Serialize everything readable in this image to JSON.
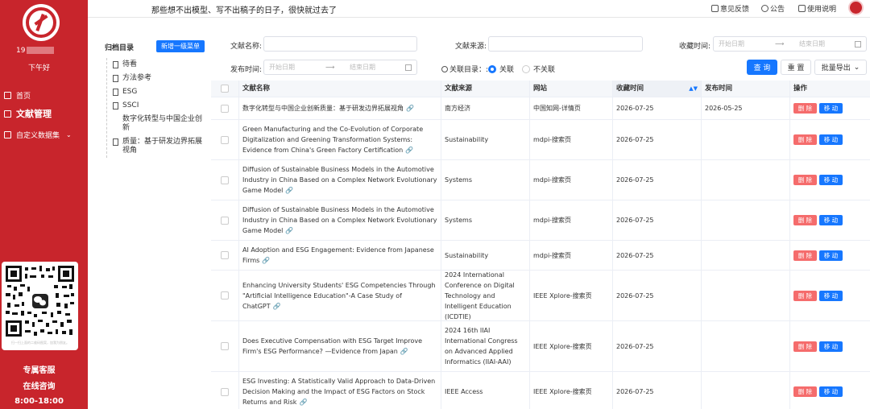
{
  "sidebar": {
    "user_id_prefix": "19",
    "greeting": "下午好",
    "nav": [
      {
        "label": "首页",
        "icon": "home-icon"
      },
      {
        "label": "文献管理",
        "icon": "document-icon"
      },
      {
        "label": "自定义数据集",
        "icon": "dataset-icon"
      }
    ],
    "qr_caption": "扫一扫上面的二维码图案，加我为朋友。",
    "service_label": "专属客服",
    "online_label": "在线咨询",
    "hours": "8:00-18:00",
    "brand_color": "#c8252c"
  },
  "topbar": {
    "slogan": "那些想不出模型、写不出稿子的日子，很快就过去了",
    "feedback": "意见反馈",
    "notice": "公告",
    "manual": "使用说明"
  },
  "tree": {
    "title": "归档目录",
    "add_button": "新增一级菜单",
    "items": [
      {
        "label": "待看",
        "doc": true
      },
      {
        "label": "方法参考",
        "doc": true
      },
      {
        "label": "ESG",
        "doc": true
      },
      {
        "label": "SSCI",
        "doc": true
      },
      {
        "label": "数字化转型与中国企业创新",
        "doc": false
      },
      {
        "label": "质量：基于研发边界拓展视角",
        "doc": true
      }
    ]
  },
  "filters": {
    "title_label": "文献名称:",
    "source_label": "文献来源:",
    "collect_time_label": "收藏时间:",
    "publish_time_label": "发布时间:",
    "start_placeholder": "开始日期",
    "end_placeholder": "结束日期",
    "date_arrow": "⟶",
    "related_label": "关联目录：:",
    "related_yes": "关联",
    "related_no": "不关联",
    "search_button": "查 询",
    "reset_button": "重 置",
    "export_button": "批量导出",
    "accent_color": "#1677ff"
  },
  "table": {
    "headers": [
      "文献名称",
      "文献来源",
      "网站",
      "收藏时间",
      "发布时间",
      "操作"
    ],
    "delete_label": "删 除",
    "move_label": "移 动",
    "link_glyph": "🔗",
    "rows": [
      {
        "title": "数字化转型与中国企业创新质量：基于研发边界拓展视角",
        "source": "南方经济",
        "site": "中国知网-详情页",
        "collected": "2026-07-25",
        "published": "2026-05-25"
      },
      {
        "title": "Green Manufacturing and the Co-Evolution of Corporate Digitalization and Greening Transformation Systems: Evidence from China's Green Factory Certification",
        "source": "Sustainability",
        "site": "mdpi-搜索页",
        "collected": "2026-07-25",
        "published": ""
      },
      {
        "title": "Diffusion of Sustainable Business Models in the Automotive Industry in China Based on a Complex Network Evolutionary Game Model",
        "source": "Systems",
        "site": "mdpi-搜索页",
        "collected": "2026-07-25",
        "published": ""
      },
      {
        "title": "Diffusion of Sustainable Business Models in the Automotive Industry in China Based on a Complex Network Evolutionary Game Model",
        "source": "Systems",
        "site": "mdpi-搜索页",
        "collected": "2026-07-25",
        "published": ""
      },
      {
        "title": "AI Adoption and ESG Engagement: Evidence from Japanese Firms",
        "source": "Sustainability",
        "site": "mdpi-搜索页",
        "collected": "2026-07-25",
        "published": ""
      },
      {
        "title": "Enhancing University Students' ESG Competencies Through \"Artificial Intelligence Education\"-A Case Study of ChatGPT",
        "source": "2024 International Conference on Digital Technology and Intelligent Education (ICDTIE)",
        "site": "IEEE Xplore-搜索页",
        "collected": "2026-07-25",
        "published": ""
      },
      {
        "title": "Does Executive Compensation with ESG Target Improve Firm's ESG Performance? —Evidence from Japan",
        "source": "2024 16th IIAI International Congress on Advanced Applied Informatics (IIAI-AAI)",
        "site": "IEEE Xplore-搜索页",
        "collected": "2026-07-25",
        "published": ""
      },
      {
        "title": "ESG Investing: A Statistically Valid Approach to Data-Driven Decision Making and the Impact of ESG Factors on Stock Returns and Risk",
        "source": "IEEE Access",
        "site": "IEEE Xplore-搜索页",
        "collected": "2026-07-25",
        "published": ""
      }
    ]
  }
}
